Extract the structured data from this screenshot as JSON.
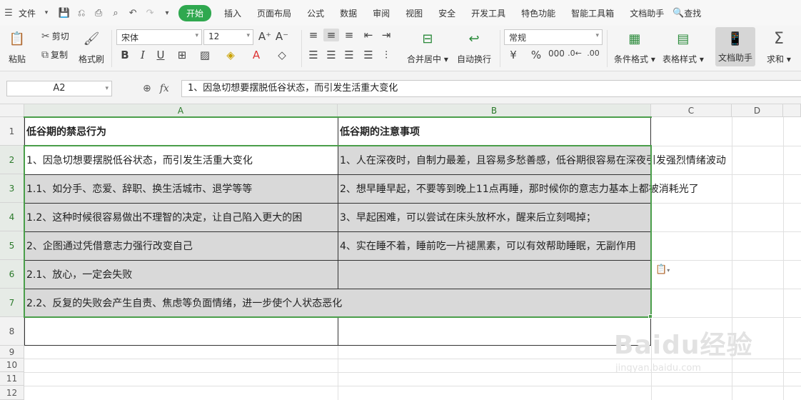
{
  "menubar": {
    "file": "文件",
    "tabs": [
      "开始",
      "插入",
      "页面布局",
      "公式",
      "数据",
      "审阅",
      "视图",
      "安全",
      "开发工具",
      "特色功能",
      "智能工具箱",
      "文档助手"
    ],
    "active_tab": "开始",
    "search": "查找"
  },
  "ribbon": {
    "paste": "粘贴",
    "cut": "剪切",
    "copy": "复制",
    "format_painter": "格式刷",
    "font_name": "宋体",
    "font_size": "12",
    "merge_center": "合并居中",
    "wrap_text": "自动换行",
    "number_format": "常规",
    "conditional_format": "条件格式",
    "table_style": "表格样式",
    "doc_helper": "文档助手",
    "sum": "求和"
  },
  "formula_bar": {
    "name_box": "A2",
    "fx": "fx",
    "content": "1、因急切想要摆脱低谷状态，而引发生活重大变化"
  },
  "columns": [
    "A",
    "B",
    "C",
    "D"
  ],
  "rows": [
    "1",
    "2",
    "3",
    "4",
    "5",
    "6",
    "7",
    "8",
    "9",
    "10",
    "11",
    "12"
  ],
  "cells": {
    "a1": "低谷期的禁忌行为",
    "b1": "低谷期的注意事项",
    "a2": "1、因急切想要摆脱低谷状态，而引发生活重大变化",
    "b2": "1、人在深夜时，自制力最差，且容易多愁善感，低谷期很容易在深夜引发强烈情绪波动",
    "a3": "1.1、如分手、恋爱、辞职、换生活城市、退学等等",
    "b3": "2、想早睡早起，不要等到晚上11点再睡，那时候你的意志力基本上都被消耗光了",
    "a4": "1.2、这种时候很容易做出不理智的决定，让自己陷入更大的困",
    "b4": "3、早起困难，可以尝试在床头放杯水，醒来后立刻喝掉；",
    "a5": "2、企图通过凭借意志力强行改变自己",
    "b5": "4、实在睡不着，睡前吃一片褪黑素，可以有效帮助睡眠，无副作用",
    "a6": "2.1、放心，一定会失败",
    "b6": "",
    "a7": "2.2、反复的失败会产生自责、焦虑等负面情绪，进一步使个人状态恶化"
  },
  "watermark": {
    "brand": "Baidu经验",
    "url": "jingyan.baidu.com"
  },
  "colors": {
    "accent": "#2fa84f",
    "selection_border": "#4a9e4a",
    "selected_fill": "#d9d9d9"
  }
}
